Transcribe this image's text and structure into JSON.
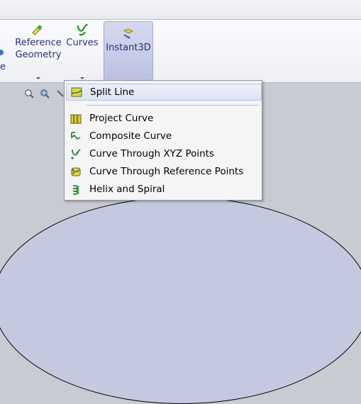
{
  "ribbon": {
    "left_clipped_letter": "e",
    "reference_geometry": {
      "line1": "Reference",
      "line2": "Geometry"
    },
    "curves": {
      "label": "Curves"
    },
    "instant3d": {
      "label": "Instant3D"
    }
  },
  "menu": {
    "items": [
      {
        "label": "Split Line",
        "icon": "split-line-icon",
        "highlighted": true
      },
      {
        "label": "Project Curve",
        "icon": "project-curve-icon"
      },
      {
        "label": "Composite Curve",
        "icon": "composite-curve-icon"
      },
      {
        "label": "Curve Through XYZ Points",
        "icon": "curve-xyz-points-icon"
      },
      {
        "label": "Curve Through Reference Points",
        "icon": "curve-reference-points-icon"
      },
      {
        "label": "Helix and Spiral",
        "icon": "helix-spiral-icon"
      }
    ]
  },
  "colors": {
    "ribbon_text": "#2a2f77",
    "instant3d_bg": "#c3c8e6",
    "canvas_bg": "#c9cbd3",
    "part_fill": "#c5c9e0"
  }
}
